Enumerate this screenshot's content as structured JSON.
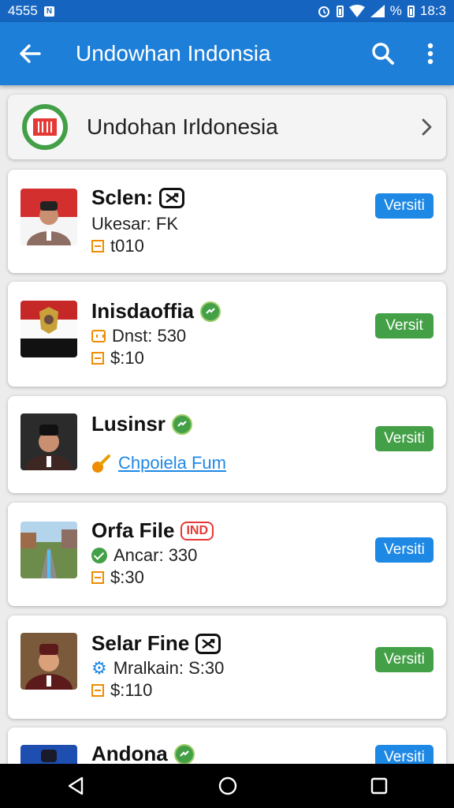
{
  "status": {
    "time_left": "4555",
    "badge": "N",
    "battery_text": "%",
    "clock": "18:3"
  },
  "appbar": {
    "title": "Undowhan Indonsia"
  },
  "country": {
    "name": "Undohan Irldonesia"
  },
  "cards": [
    {
      "title": "Sclen:",
      "line1": "Ukesar: FK",
      "line2": "t010",
      "button": "Versiti",
      "button_color": "#1e88e5"
    },
    {
      "title": "Inisdaoffia",
      "line1": "Dnst: 530",
      "line2": "$:10",
      "button": "Versit",
      "button_color": "#43a047"
    },
    {
      "title": "Lusinsr",
      "line1": "Chpoiela Fum",
      "button": "Versiti",
      "button_color": "#43a047"
    },
    {
      "title": "Orfa File",
      "badge": "IND",
      "line1": "Ancar: 330",
      "line2": "$:30",
      "button": "Versiti",
      "button_color": "#1e88e5"
    },
    {
      "title": "Selar Fine",
      "line1": "Mralkain: S:30",
      "line2": "$:110",
      "button": "Versiti",
      "button_color": "#43a047"
    },
    {
      "title": "Andona",
      "button": "Versiti",
      "button_color": "#1e88e5"
    }
  ],
  "icons": {
    "back": "arrow-left-icon",
    "search": "search-icon",
    "menu": "more-vert-icon",
    "chevron": "chevron-right-icon",
    "verified": "verified-badge-icon"
  }
}
